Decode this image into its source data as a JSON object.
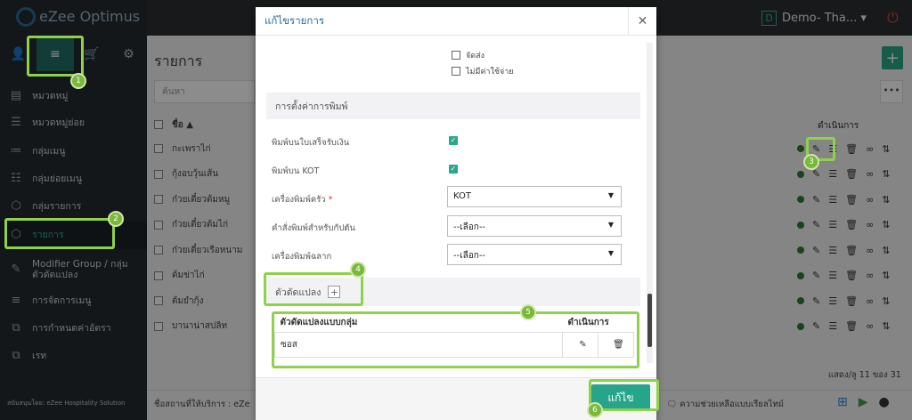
{
  "app": {
    "logo_text": "eZee Optimus",
    "demo_letter": "D",
    "demo_label": "Demo- Tha... ▾"
  },
  "sidebar": {
    "tabs": [
      "👤",
      "≡",
      "🛒",
      "⚙"
    ],
    "items": [
      {
        "label": "หมวดหมู่",
        "icon": "menu-grid-icon"
      },
      {
        "label": "หมวดหมู่ย่อย",
        "icon": "submenu-icon"
      },
      {
        "label": "กลุ่มเมนู",
        "icon": "list-icon"
      },
      {
        "label": "กลุ่มย่อยเมนู",
        "icon": "sublist-icon"
      },
      {
        "label": "กลุ่มรายการ",
        "icon": "box-icon"
      },
      {
        "label": "รายการ",
        "icon": "cube-icon"
      },
      {
        "label": "Modifier Group / กลุ่มตัวดัดแปลง",
        "icon": "edit-icon"
      },
      {
        "label": "การจัดการเมนู",
        "icon": "manage-icon"
      },
      {
        "label": "การกำหนดค่าอัตรา",
        "icon": "rate-icon"
      },
      {
        "label": "เรท",
        "icon": "tax-icon"
      }
    ],
    "footer": "สนับสนุนโดย: eZee Hospitality Solution"
  },
  "page": {
    "title": "รายการ",
    "search_placeholder": "ค้นหา",
    "col_name": "ชื่อ ▲",
    "col_actions": "ดำเนินการ",
    "rows": [
      "กะเพราไก่",
      "กุ้งอบวุ้นเส้น",
      "ก๋วยเตี๋ยวต้มหมู",
      "ก๋วยเตี๋ยวต้มไก่",
      "ก๋วยเตี๋ยวเรือหนาม",
      "ต้มข่าไก่",
      "ต้มยำกุ้ง",
      "บานาน่าสปลิท"
    ],
    "pager": "แสดง/ลู 11 ของ 31",
    "footer_left": "ชื่อสถานที่ให้บริการ : eZe",
    "footer_help": "ความช่วยเหลือแบบเรียลไทม์"
  },
  "modal": {
    "title": "แก้ไขรายการ",
    "checkbox_delivery": "จัดส่ง",
    "checkbox_nocharge": "ไม่มีค่าใช้จ่าย",
    "print_section": "การตั้งค่าการพิมพ์",
    "print_receipt_label": "พิมพ์บนใบเสร็จรับเงิน",
    "print_kot_label": "พิมพ์บน KOT",
    "kitchen_printer_label": "เครื่องพิมพ์ครัว",
    "kitchen_printer_value": "KOT",
    "bill_printer_label": "คำสั่งพิมพ์สำหรับกัปตัน",
    "bill_printer_value": "--เลือก--",
    "label_printer_label": "เครื่องพิมพ์ฉลาก",
    "label_printer_value": "--เลือก--",
    "modifier_section": "ตัวดัดแปลง",
    "table_col_group": "ตัวดัดแปลงแบบกลุ่ม",
    "table_col_actions": "ดำเนินการ",
    "table_rows": [
      "ซอส"
    ],
    "save_label": "แก้ไข"
  },
  "badges": [
    "1",
    "2",
    "3",
    "4",
    "5",
    "6"
  ]
}
